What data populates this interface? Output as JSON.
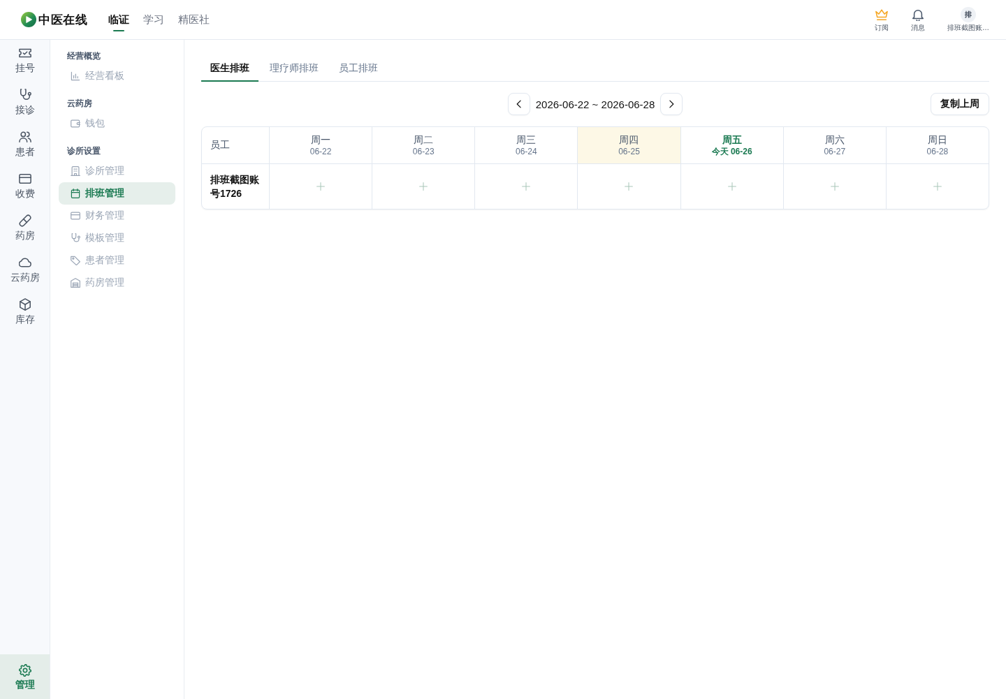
{
  "header": {
    "logo": {
      "text": "中医在线"
    },
    "nav": [
      {
        "label": "临证",
        "selected": true
      },
      {
        "label": "学习",
        "selected": false
      },
      {
        "label": "精医社",
        "selected": false
      }
    ],
    "actions": [
      {
        "label": "订阅"
      },
      {
        "label": "消息"
      }
    ],
    "user": {
      "avatar": "排",
      "name": "排班截图账…"
    }
  },
  "rail": {
    "items": [
      {
        "label": "挂号",
        "selected": false
      },
      {
        "label": "接诊",
        "selected": false
      },
      {
        "label": "患者",
        "selected": false
      },
      {
        "label": "收费",
        "selected": false
      },
      {
        "label": "药房",
        "selected": false
      },
      {
        "label": "云药房",
        "selected": false
      },
      {
        "label": "库存",
        "selected": false
      }
    ],
    "footer": {
      "label": "管理",
      "selected": true
    }
  },
  "sidebar": {
    "groups": [
      {
        "title": "经营概览",
        "items": [
          {
            "label": "经营看板",
            "selected": false
          }
        ]
      },
      {
        "title": "云药房",
        "items": [
          {
            "label": "钱包",
            "selected": false
          }
        ]
      },
      {
        "title": "诊所设置",
        "items": [
          {
            "label": "诊所管理",
            "selected": false
          },
          {
            "label": "排班管理",
            "selected": true
          },
          {
            "label": "财务管理",
            "selected": false
          },
          {
            "label": "模板管理",
            "selected": false
          },
          {
            "label": "患者管理",
            "selected": false
          },
          {
            "label": "药房管理",
            "selected": false
          }
        ]
      }
    ]
  },
  "main": {
    "tabs": [
      {
        "label": "医生排班",
        "selected": true
      },
      {
        "label": "理疗师排班",
        "selected": false
      },
      {
        "label": "员工排班",
        "selected": false
      }
    ],
    "week": {
      "range": "2026-06-22 ~ 2026-06-28"
    },
    "copy_button": "复制上周",
    "table": {
      "staff_column": "员工",
      "days": [
        {
          "weekday": "周一",
          "date": "06-22",
          "highlighted": false,
          "today": false
        },
        {
          "weekday": "周二",
          "date": "06-23",
          "highlighted": false,
          "today": false
        },
        {
          "weekday": "周三",
          "date": "06-24",
          "highlighted": false,
          "today": false
        },
        {
          "weekday": "周四",
          "date": "06-25",
          "highlighted": true,
          "today": false
        },
        {
          "weekday": "周五",
          "date": "今天 06-26",
          "highlighted": false,
          "today": true
        },
        {
          "weekday": "周六",
          "date": "06-27",
          "highlighted": false,
          "today": false
        },
        {
          "weekday": "周日",
          "date": "06-28",
          "highlighted": false,
          "today": false
        }
      ],
      "rows": [
        {
          "name": "排班截图账号1726",
          "cells": [
            {
              "kind": "empty"
            },
            {
              "kind": "empty"
            },
            {
              "kind": "empty"
            },
            {
              "kind": "empty"
            },
            {
              "kind": "empty"
            },
            {
              "kind": "empty"
            },
            {
              "kind": "empty"
            }
          ]
        }
      ]
    }
  }
}
